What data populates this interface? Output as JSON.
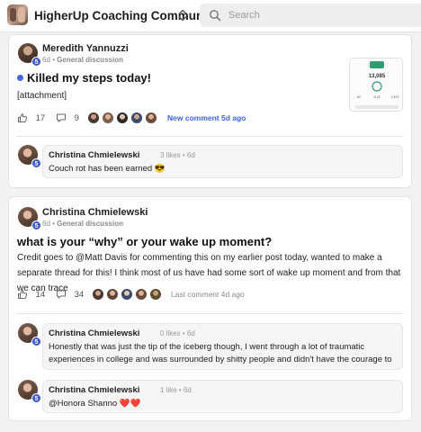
{
  "header": {
    "community_name": "HigherUp Coaching Community",
    "search_placeholder": "Search"
  },
  "posts": [
    {
      "author": "Meredith Yannuzzi",
      "level": "5",
      "time": "6d",
      "category": "General discussion",
      "title": "Killed my steps today!",
      "unread": true,
      "body": "[attachment]",
      "likes": "17",
      "comments": "9",
      "activity": "New comment 5d ago",
      "attachment": {
        "steps": "13,085",
        "metrics": [
          "62",
          "6.18",
          "2,497"
        ]
      },
      "preview_comments": [
        {
          "author": "Christina Chmielewski",
          "level": "5",
          "meta": "3 likes • 6d",
          "text": "Couch rot has been earned 😎"
        }
      ]
    },
    {
      "author": "Christina Chmielewski",
      "level": "5",
      "time": "6d",
      "category": "General discussion",
      "title": "what is your “why” or your wake up moment?",
      "unread": false,
      "body": "Credit goes to @Matt Davis for commenting this on my earlier post today, wanted to make a separate thread for this! I think most of us have had some sort of wake up moment and from that we can trace",
      "likes": "14",
      "comments": "34",
      "activity": "Last comment 4d ago",
      "preview_comments": [
        {
          "author": "Christina Chmielewski",
          "level": "5",
          "meta": "0 likes • 6d",
          "text": "Honestly that was just the tip of the iceberg though, I went through a lot of traumatic experiences in college and was surrounded by shitty people and didn't have the courage to"
        },
        {
          "author": "Christina Chmielewski",
          "level": "5",
          "meta": "1 like • 6d",
          "text": "@Honora Shanno ❤️❤️"
        }
      ]
    }
  ],
  "colors": {
    "accent": "#3e57c9",
    "new_activity": "#3e63d9",
    "unread_dot": "#4169e1"
  }
}
